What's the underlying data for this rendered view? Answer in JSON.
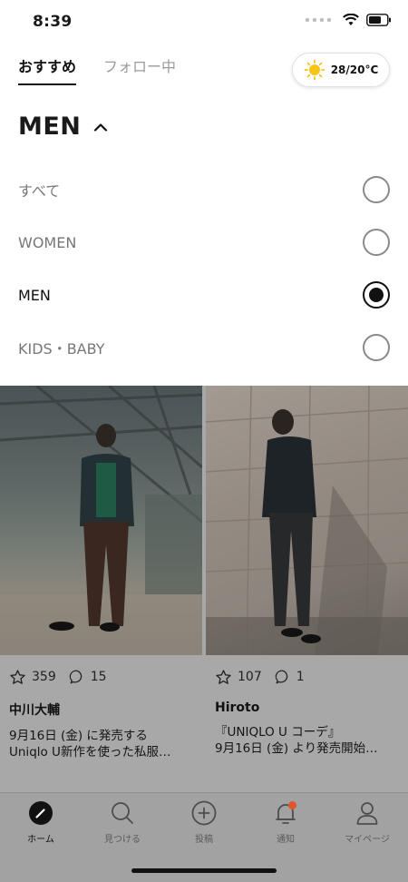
{
  "status_bar": {
    "time": "8:39"
  },
  "tabs": [
    {
      "label": "おすすめ",
      "active": true
    },
    {
      "label": "フォロー中",
      "active": false
    }
  ],
  "weather": {
    "temp": "28/20°C",
    "icon": "sun-icon"
  },
  "category": {
    "title": "MEN",
    "expanded": true
  },
  "category_options": [
    {
      "label": "すべて",
      "selected": false
    },
    {
      "label": "WOMEN",
      "selected": false
    },
    {
      "label": "MEN",
      "selected": true
    },
    {
      "label": "KIDS・BABY",
      "selected": false
    }
  ],
  "posts": [
    {
      "likes": "359",
      "comments": "15",
      "author": "中川大輔",
      "line1": "9月16日 (金) に発売する",
      "line2": "Uniqlo U新作を使った私服…"
    },
    {
      "likes": "107",
      "comments": "1",
      "author": "Hiroto",
      "line1": "『UNIQLO U コーデ』",
      "line2": "9月16日 (金) より発売開始…"
    }
  ],
  "bottom_nav": [
    {
      "label": "ホーム",
      "icon": "home-icon",
      "active": true
    },
    {
      "label": "見つける",
      "icon": "search-icon",
      "active": false
    },
    {
      "label": "投稿",
      "icon": "plus-icon",
      "active": false
    },
    {
      "label": "通知",
      "icon": "bell-icon",
      "active": false
    },
    {
      "label": "マイページ",
      "icon": "user-icon",
      "active": false
    }
  ],
  "colors": {
    "accent_badge": "#e0552b",
    "overlay": "#a8a8a8"
  }
}
